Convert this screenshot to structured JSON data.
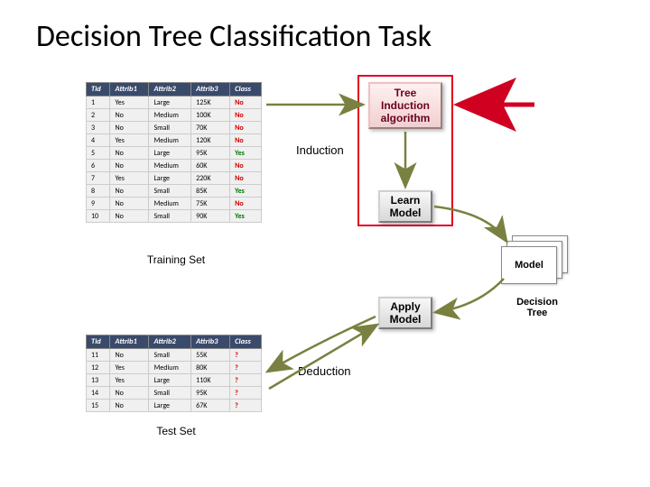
{
  "title": "Decision Tree Classification Task",
  "trainingSet": {
    "caption": "Training Set",
    "headers": [
      "Tid",
      "Attrib1",
      "Attrib2",
      "Attrib3",
      "Class"
    ],
    "rows": [
      [
        "1",
        "Yes",
        "Large",
        "125K",
        "No"
      ],
      [
        "2",
        "No",
        "Medium",
        "100K",
        "No"
      ],
      [
        "3",
        "No",
        "Small",
        "70K",
        "No"
      ],
      [
        "4",
        "Yes",
        "Medium",
        "120K",
        "No"
      ],
      [
        "5",
        "No",
        "Large",
        "95K",
        "Yes"
      ],
      [
        "6",
        "No",
        "Medium",
        "60K",
        "No"
      ],
      [
        "7",
        "Yes",
        "Large",
        "220K",
        "No"
      ],
      [
        "8",
        "No",
        "Small",
        "85K",
        "Yes"
      ],
      [
        "9",
        "No",
        "Medium",
        "75K",
        "No"
      ],
      [
        "10",
        "No",
        "Small",
        "90K",
        "Yes"
      ]
    ]
  },
  "testSet": {
    "caption": "Test Set",
    "headers": [
      "Tid",
      "Attrib1",
      "Attrib2",
      "Attrib3",
      "Class"
    ],
    "rows": [
      [
        "11",
        "No",
        "Small",
        "55K",
        "?"
      ],
      [
        "12",
        "Yes",
        "Medium",
        "80K",
        "?"
      ],
      [
        "13",
        "Yes",
        "Large",
        "110K",
        "?"
      ],
      [
        "14",
        "No",
        "Small",
        "95K",
        "?"
      ],
      [
        "15",
        "No",
        "Large",
        "67K",
        "?"
      ]
    ]
  },
  "boxes": {
    "treeInduction": "Tree\nInduction\nalgorithm",
    "learnModel": "Learn\nModel",
    "applyModel": "Apply\nModel",
    "model": "Model"
  },
  "labels": {
    "induction": "Induction",
    "deduction": "Deduction",
    "decisionTree": "Decision\nTree"
  }
}
